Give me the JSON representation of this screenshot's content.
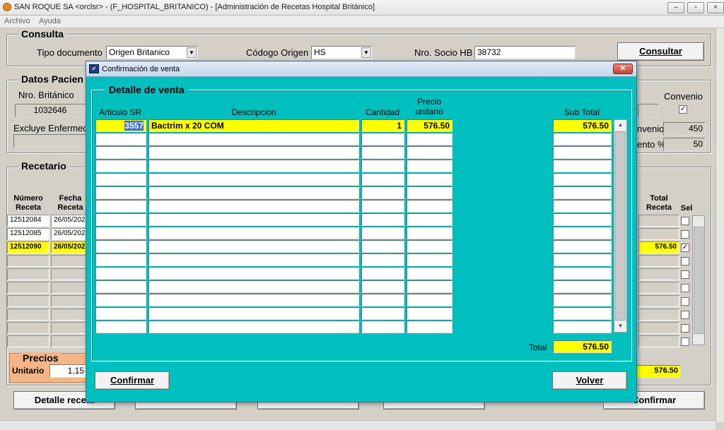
{
  "window": {
    "title": "SAN ROQUE SA <orclsr> - (F_HOSPITAL_BRITANICO) - [Administración de Recetas Hospital Británico]",
    "minimize": "–",
    "restore": "▫",
    "close": "×"
  },
  "menu": {
    "items": [
      "Archivo",
      "Ayuda"
    ]
  },
  "consulta": {
    "title": "Consulta",
    "tipo_label": "Tipo documento",
    "tipo_value": "Origen Britanico",
    "codigo_label": "Códogo Origen",
    "codigo_value": "HS",
    "socio_label": "Nro. Socio HB",
    "socio_value": "38732",
    "consultar_label": "Consultar"
  },
  "datos": {
    "title": "Datos Pacien",
    "nro_label": "Nro. Británico",
    "nro_value": "1032646",
    "excluye_label": "Excluye Enfermed",
    "convenio_label": "Convenio",
    "convenio_check": "✓",
    "convenio_num_label": "nvenio",
    "convenio_num_value": "450",
    "descuento_label": "ento %",
    "descuento_value": "50"
  },
  "recetario": {
    "title": "Recetario",
    "col_numero": "Número Receta",
    "col_fecha": "Fecha Receta",
    "col_total": "Total Receta",
    "col_sel": "Sel",
    "rows": [
      {
        "numero": "12512084",
        "fecha": "26/05/202",
        "total": "",
        "sel": ""
      },
      {
        "numero": "12512085",
        "fecha": "26/05/202",
        "total": "",
        "sel": ""
      },
      {
        "numero": "12512090",
        "fecha": "26/05/202",
        "total": "576.50",
        "sel": "✓"
      }
    ]
  },
  "precios": {
    "title": "Precios",
    "unitario_label": "Unitario",
    "unitario_value": "1,15",
    "total_value": "576.50"
  },
  "bottom_buttons": {
    "detalle": "Detalle receta",
    "confirmar": "Confirmar"
  },
  "dialog": {
    "title": "Confirmación de venta",
    "icon": "✐",
    "close": "✕",
    "group_title": "Detalle de venta",
    "col_articulo": "Articulo SR",
    "col_descripcion": "Descripción",
    "col_cantidad": "Cantidad",
    "col_precio": "Precio unitario",
    "col_subtotal": "Sub Total",
    "row": {
      "articulo": "3557",
      "descripcion": "Bactrim x 20 COM",
      "cantidad": "1",
      "precio": "576.50",
      "subtotal": "576.50"
    },
    "total_label": "Total",
    "total_value": "576.50",
    "confirmar_label": "Confirmar",
    "volver_label": "Volver"
  }
}
